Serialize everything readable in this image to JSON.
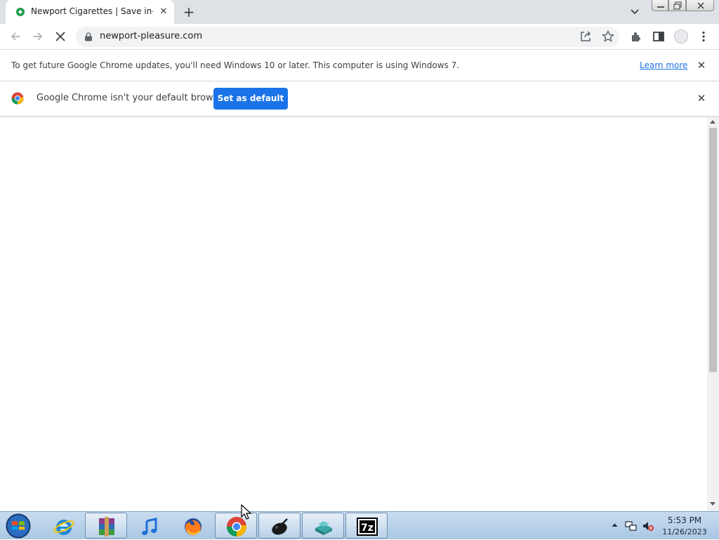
{
  "browser": {
    "tab": {
      "title": "Newport Cigarettes | Save in-store",
      "favicon": "newport-favicon-icon"
    },
    "new_tab_icon": "plus-icon",
    "url": "newport-pleasure.com"
  },
  "infobars": {
    "update": {
      "message": "To get future Google Chrome updates, you'll need Windows 10 or later. This computer is using Windows 7.",
      "link": "Learn more"
    },
    "default_browser": {
      "message": "Google Chrome isn't your default browser",
      "button": "Set as default"
    }
  },
  "taskbar": {
    "apps": [
      {
        "name": "internet-explorer-icon"
      },
      {
        "name": "winrar-icon"
      },
      {
        "name": "itunes-icon"
      },
      {
        "name": "firefox-icon"
      },
      {
        "name": "chrome-icon"
      },
      {
        "name": "app-icon"
      },
      {
        "name": "network-app-icon"
      },
      {
        "name": "7zip-icon"
      }
    ],
    "clock": {
      "time": "5:53 PM",
      "date": "11/26/2023"
    },
    "seven_zip_label": "7z"
  },
  "colors": {
    "accent": "#1a73e8",
    "tabstrip": "#dee1e6",
    "omnibox": "#f1f3f4"
  }
}
